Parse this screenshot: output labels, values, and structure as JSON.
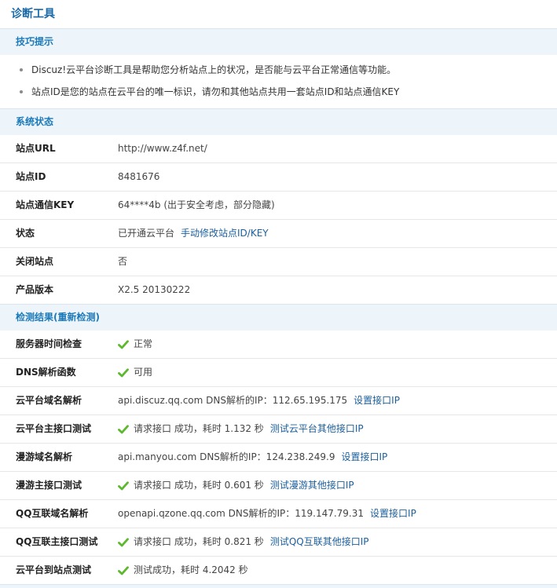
{
  "page": {
    "title": "诊断工具"
  },
  "tips": {
    "header": "技巧提示",
    "items": [
      "Discuz!云平台诊断工具是帮助您分析站点上的状况，是否能与云平台正常通信等功能。",
      "站点ID是您的站点在云平台的唯一标识，请勿和其他站点共用一套站点ID和站点通信KEY"
    ]
  },
  "status": {
    "header": "系统状态",
    "rows": [
      {
        "label": "站点URL",
        "value": "http://www.z4f.net/"
      },
      {
        "label": "站点ID",
        "value": "8481676"
      },
      {
        "label": "站点通信KEY",
        "value": "64****4b (出于安全考虑，部分隐藏)"
      },
      {
        "label": "状态",
        "value": "已开通云平台",
        "link": "手动修改站点ID/KEY"
      },
      {
        "label": "关闭站点",
        "value": "否"
      },
      {
        "label": "产品版本",
        "value": "X2.5 20130222"
      }
    ]
  },
  "results": {
    "header": "检测结果(重新检测)",
    "rows": [
      {
        "label": "服务器时间检查",
        "check": true,
        "value": "正常"
      },
      {
        "label": "DNS解析函数",
        "check": true,
        "value": "可用"
      },
      {
        "label": "云平台域名解析",
        "value": "api.discuz.qq.com DNS解析的IP：112.65.195.175",
        "link": "设置接口IP"
      },
      {
        "label": "云平台主接口测试",
        "check": true,
        "value": "请求接口 成功，耗时 1.132 秒",
        "link": "测试云平台其他接口IP"
      },
      {
        "label": "漫游域名解析",
        "value": "api.manyou.com DNS解析的IP：124.238.249.9",
        "link": "设置接口IP"
      },
      {
        "label": "漫游主接口测试",
        "check": true,
        "value": "请求接口 成功，耗时 0.601 秒",
        "link": "测试漫游其他接口IP"
      },
      {
        "label": "QQ互联域名解析",
        "value": "openapi.qzone.qq.com DNS解析的IP：119.147.79.31",
        "link": "设置接口IP"
      },
      {
        "label": "QQ互联主接口测试",
        "check": true,
        "value": "请求接口 成功，耗时 0.821 秒",
        "link": "测试QQ互联其他接口IP"
      },
      {
        "label": "云平台到站点测试",
        "check": true,
        "value": "测试成功，耗时 4.2042 秒"
      }
    ]
  },
  "colors": {
    "accent": "#1b79b9",
    "link": "#1b5f9e",
    "check": "#5cb82c",
    "header_bg": "#edf5fb"
  }
}
